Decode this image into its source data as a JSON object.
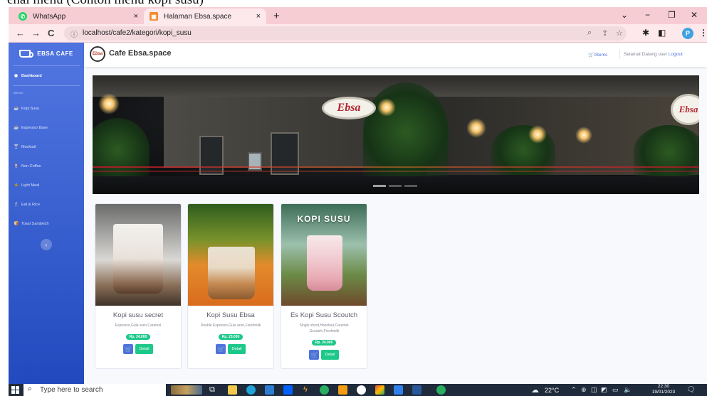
{
  "caption": "enai menu (Contoh menu kopi susu)",
  "browser": {
    "tabs": [
      {
        "label": "WhatsApp",
        "close": "×"
      },
      {
        "label": "Halaman Ebsa.space",
        "close": "×"
      }
    ],
    "new_tab": "+",
    "window_controls": [
      "⌄",
      "−",
      "❐",
      "✕"
    ],
    "url": "localhost/cafe2/kategori/kopi_susu",
    "nav": {
      "back": "←",
      "forward": "→",
      "reload": "C",
      "info": "ⓘ"
    },
    "omni_icons": [
      "⌕",
      "⇪",
      "☆"
    ],
    "extension_icons": [
      "✱",
      "◧"
    ],
    "profile_initial": "P",
    "menu": "⋮"
  },
  "sidebar": {
    "brand": "EBSA CAFE",
    "dashboard": "Dashboard",
    "heading": "MENU",
    "items": [
      {
        "label": "Kopi Susu",
        "icon": "☕"
      },
      {
        "label": "Espresso Base",
        "icon": "☕"
      },
      {
        "label": "Mocktail",
        "icon": "🍸"
      },
      {
        "label": "Non Coffee",
        "icon": "🍹"
      },
      {
        "label": "Light Meal",
        "icon": "🍲"
      },
      {
        "label": "Eat & Rice",
        "icon": "🍴"
      },
      {
        "label": "Toast Sandwich",
        "icon": "🍞"
      }
    ],
    "toggle": "‹"
  },
  "topbar": {
    "logo_text": "Ebsa",
    "site_title": "Cafe Ebsa.space",
    "cart_label": "0items",
    "welcome": "Selamat Datang user",
    "logout": "Logout"
  },
  "banner": {
    "sign_text": "Ebsa"
  },
  "products": [
    {
      "title": "Kopi susu secret",
      "desc": "Espresso,Gula aren,Caramel",
      "price": "Rp. 24.000",
      "detail": "Detail"
    },
    {
      "title": "Kopi Susu Ebsa",
      "desc": "Double Espresso,Gula aren,Freshmilk",
      "price": "Rp. 23.000",
      "detail": "Detail"
    },
    {
      "title": "Es Kopi Susu Scoutch",
      "desc": "Single shoot,Hazelnut,Caramel ,Scoutch,Freshmilk",
      "price": "Rp. 24.000",
      "detail": "Detail",
      "photo_text": "KOPI SUSU"
    }
  ],
  "taskbar": {
    "search_placeholder": "Type here to search",
    "temperature": "22°C",
    "time": "22:30",
    "date": "19/01/2023"
  }
}
